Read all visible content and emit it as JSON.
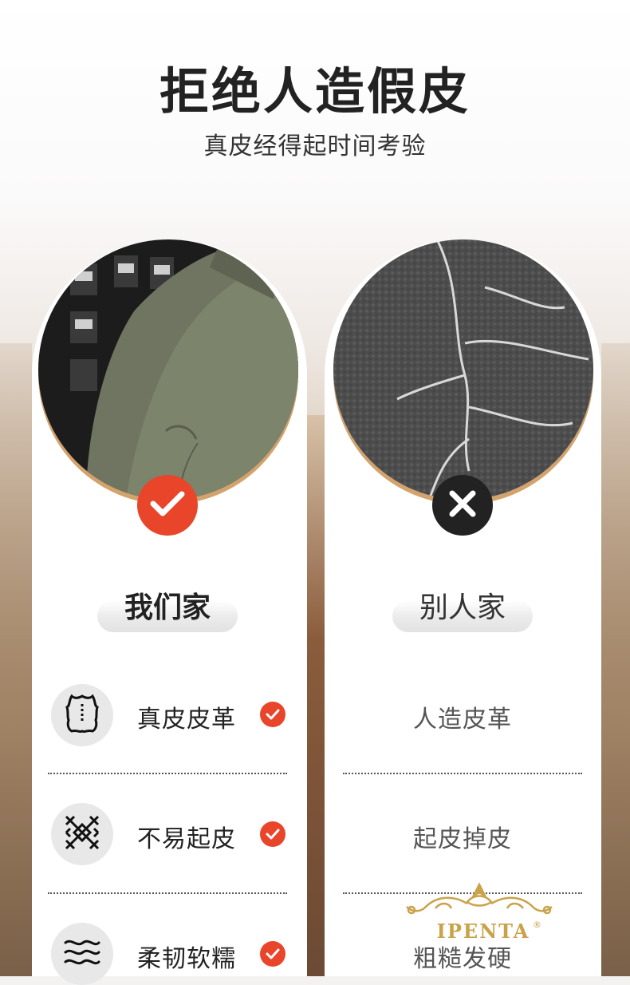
{
  "header": {
    "title": "拒绝人造假皮",
    "subtitle": "真皮经得起时间考验"
  },
  "left_column": {
    "label": "我们家",
    "badge_icon": "check-icon",
    "accent_color": "#e8452a",
    "rows": [
      {
        "icon": "leather-hide-icon",
        "text": "真皮皮革"
      },
      {
        "icon": "woven-texture-icon",
        "text": "不易起皮"
      },
      {
        "icon": "waves-icon",
        "text": "柔韧软糯"
      }
    ]
  },
  "right_column": {
    "label": "别人家",
    "badge_icon": "cross-icon",
    "rows": [
      {
        "text": "人造皮革"
      },
      {
        "text": "起皮掉皮"
      },
      {
        "text": "粗糙发硬"
      }
    ]
  },
  "watermark": {
    "brand": "IPENTA",
    "registered": "®"
  }
}
